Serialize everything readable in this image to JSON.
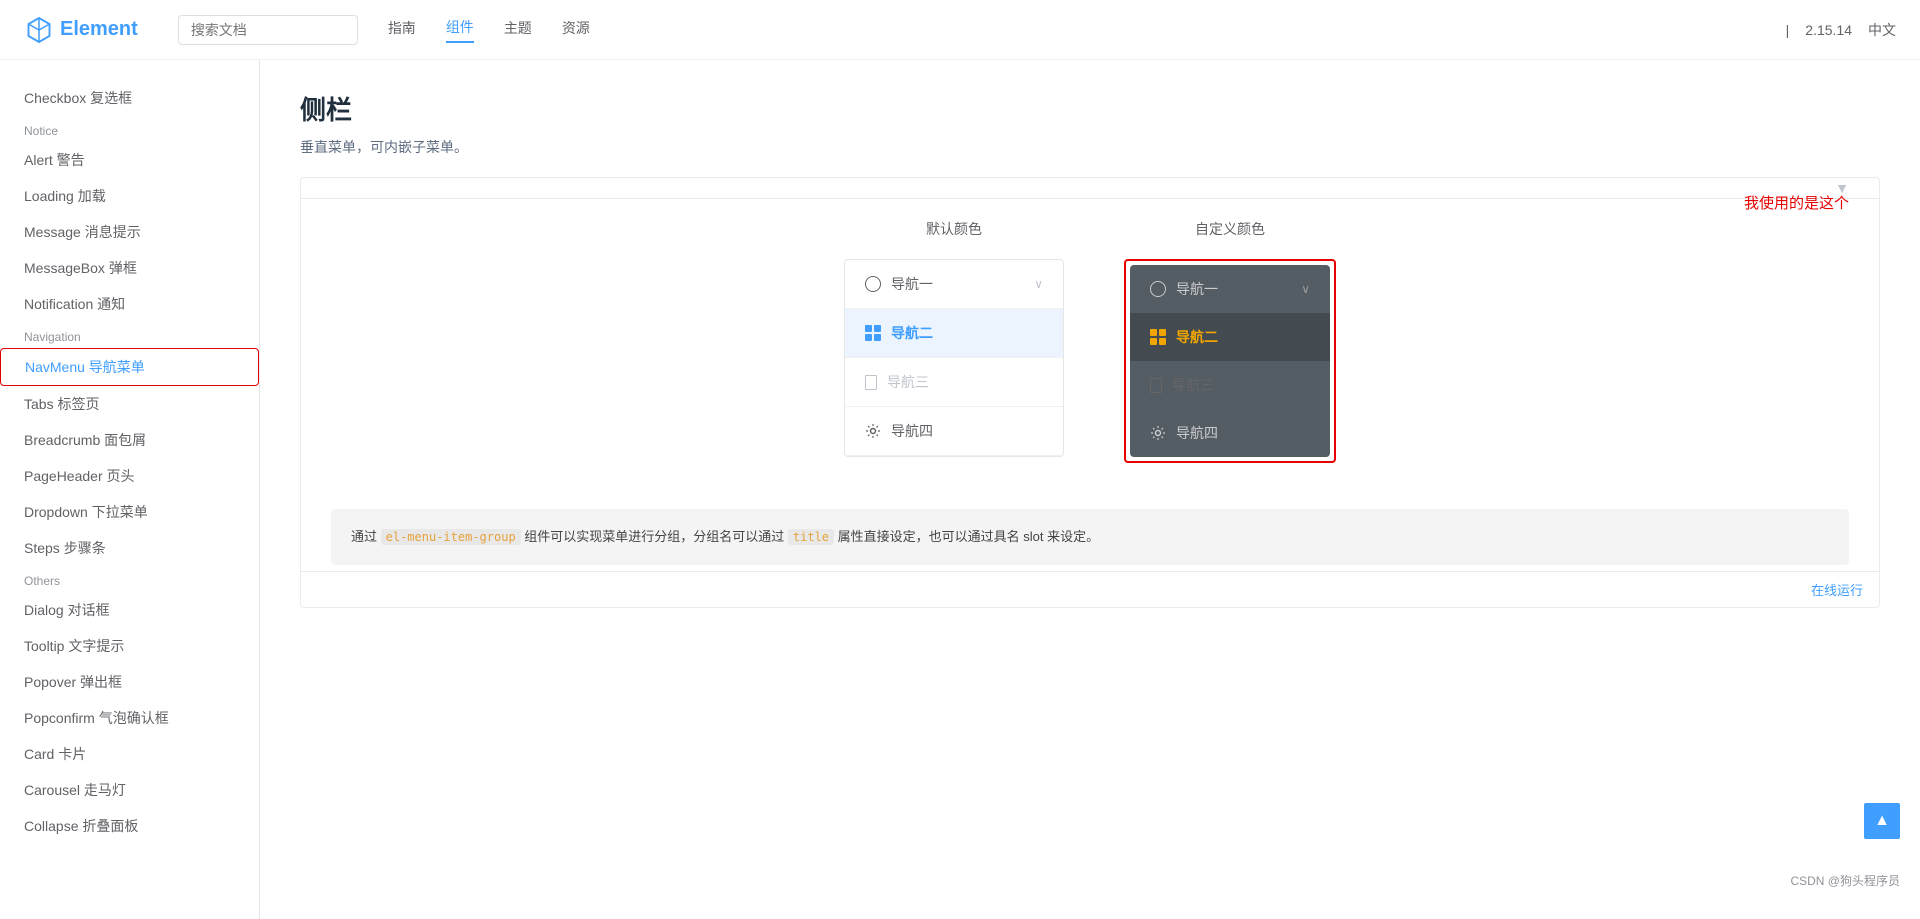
{
  "header": {
    "logo_text": "Element",
    "search_placeholder": "搜索文档",
    "nav_items": [
      {
        "label": "指南",
        "active": false
      },
      {
        "label": "组件",
        "active": true
      },
      {
        "label": "主题",
        "active": false
      },
      {
        "label": "资源",
        "active": false
      }
    ],
    "version": "2.15.14",
    "language": "中文"
  },
  "sidebar": {
    "categories": [
      {
        "label": "",
        "items": [
          {
            "label": "Checkbox 复选框",
            "active": false
          }
        ]
      },
      {
        "label": "Notice",
        "items": [
          {
            "label": "Alert 警告",
            "active": false
          },
          {
            "label": "Loading 加载",
            "active": false
          },
          {
            "label": "Message 消息提示",
            "active": false
          },
          {
            "label": "MessageBox 弹框",
            "active": false
          },
          {
            "label": "Notification 通知",
            "active": false
          }
        ]
      },
      {
        "label": "Navigation",
        "items": [
          {
            "label": "NavMenu 导航菜单",
            "active": true
          },
          {
            "label": "Tabs 标签页",
            "active": false
          },
          {
            "label": "Breadcrumb 面包屑",
            "active": false
          },
          {
            "label": "PageHeader 页头",
            "active": false
          },
          {
            "label": "Dropdown 下拉菜单",
            "active": false
          },
          {
            "label": "Steps 步骤条",
            "active": false
          }
        ]
      },
      {
        "label": "Others",
        "items": [
          {
            "label": "Dialog 对话框",
            "active": false
          },
          {
            "label": "Tooltip 文字提示",
            "active": false
          },
          {
            "label": "Popover 弹出框",
            "active": false
          },
          {
            "label": "Popconfirm 气泡确认框",
            "active": false
          },
          {
            "label": "Card 卡片",
            "active": false
          },
          {
            "label": "Carousel 走马灯",
            "active": false
          },
          {
            "label": "Collapse 折叠面板",
            "active": false
          }
        ]
      }
    ]
  },
  "main": {
    "title": "侧栏",
    "description": "垂直菜单，可内嵌子菜单。",
    "annotation": "我使用的是这个",
    "demo": {
      "default_color_label": "默认颜色",
      "custom_color_label": "自定义颜色",
      "menu_items": [
        {
          "icon": "circle",
          "label": "导航一",
          "has_chevron": true,
          "disabled": false
        },
        {
          "icon": "grid",
          "label": "导航二",
          "has_chevron": false,
          "disabled": false,
          "active": true
        },
        {
          "icon": "doc",
          "label": "导航三",
          "has_chevron": false,
          "disabled": true
        },
        {
          "icon": "gear",
          "label": "导航四",
          "has_chevron": false,
          "disabled": false
        }
      ]
    },
    "info_text_1": "通过",
    "info_code": "el-menu-item-group",
    "info_text_2": "组件可以实现菜单进行分组，分组名可以通过",
    "info_code2": "title",
    "info_text_3": "属性直接设定，也可以通过具名 slot 来设定。",
    "run_label": "在线运行"
  },
  "footer": {
    "scroll_up_icon": "▲",
    "csdn_label": "CSDN @狗头程序员"
  }
}
